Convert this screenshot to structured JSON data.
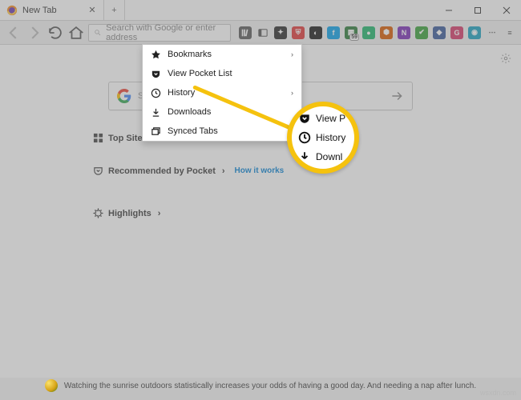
{
  "titlebar": {
    "tab_label": "New Tab",
    "newtab_glyph": "+",
    "min": "–",
    "max": "☐",
    "close": "✕"
  },
  "toolbar": {
    "url_placeholder": "Search with Google or enter address"
  },
  "dropdown": {
    "items": [
      {
        "icon": "star",
        "label": "Bookmarks",
        "submenu": true
      },
      {
        "icon": "pocket",
        "label": "View Pocket List",
        "submenu": false
      },
      {
        "icon": "clock",
        "label": "History",
        "submenu": true
      },
      {
        "icon": "download",
        "label": "Downloads",
        "submenu": false
      },
      {
        "icon": "tabs",
        "label": "Synced Tabs",
        "submenu": false
      }
    ]
  },
  "content": {
    "search_placeholder": "Search the Web",
    "top_sites": "Top Sites",
    "recommended": "Recommended by Pocket",
    "how_it_works": "How it works",
    "highlights": "Highlights"
  },
  "callout": {
    "row1": "View P",
    "row2": "History",
    "row3": "Downl"
  },
  "footer": {
    "text": "Watching the sunrise outdoors statistically increases your odds of having a good day. And needing a nap after lunch."
  },
  "watermark": "wsxdn.com",
  "ext_badge": "59"
}
